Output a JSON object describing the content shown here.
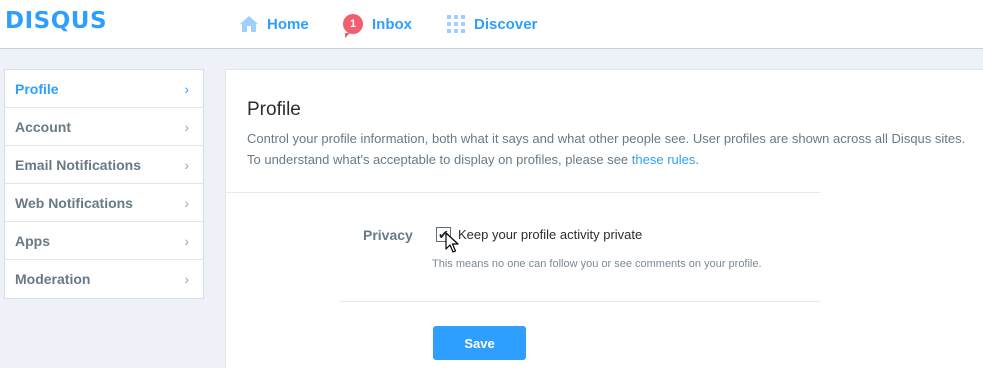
{
  "header": {
    "logo": "DISQUS",
    "nav": {
      "home": "Home",
      "inbox": "Inbox",
      "inbox_count": "1",
      "discover": "Discover"
    }
  },
  "sidebar": {
    "items": [
      {
        "label": "Profile",
        "active": true
      },
      {
        "label": "Account"
      },
      {
        "label": "Email Notifications"
      },
      {
        "label": "Web Notifications"
      },
      {
        "label": "Apps"
      },
      {
        "label": "Moderation"
      }
    ]
  },
  "main": {
    "title": "Profile",
    "description": "Control your profile information, both what it says and what other people see. User profiles are shown across all Disqus sites. To understand what's acceptable to display on profiles, please see ",
    "rules_link": "these rules",
    "description_end": ".",
    "privacy": {
      "label": "Privacy",
      "checkbox_label": "Keep your profile activity private",
      "checked": true,
      "hint": "This means no one can follow you or see comments on your profile."
    },
    "save_label": "Save"
  },
  "colors": {
    "accent": "#2e9fff",
    "badge": "#f05f70",
    "muted_text": "#687a86",
    "page_bg": "#eef2f8"
  },
  "icons": {
    "home": "home-icon",
    "inbox": "inbox-badge",
    "discover": "grid-icon",
    "chevron": "chevron-right-icon",
    "cursor": "mouse-pointer-icon"
  }
}
